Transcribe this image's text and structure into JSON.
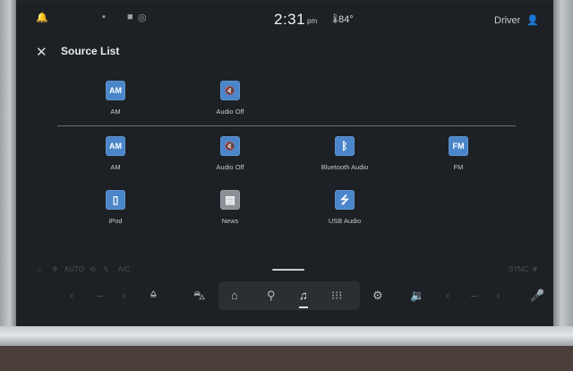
{
  "status_bar": {
    "time": "2:31",
    "ampm": "pm",
    "temperature": "84°",
    "user": "Driver",
    "icons": [
      "notification-bell-icon",
      "chat-icon",
      "message-icon",
      "target-icon",
      "thermometer-icon",
      "person-icon"
    ]
  },
  "header": {
    "title": "Source List",
    "close_icon": "close-icon"
  },
  "recent_sources": [
    {
      "label": "AM",
      "icon": "am-radio-icon",
      "tile_text": "AM"
    },
    {
      "label": "Audio Off",
      "icon": "audio-off-icon",
      "tile_text": "🔇"
    }
  ],
  "all_sources": [
    {
      "label": "AM",
      "icon": "am-radio-icon",
      "tile_text": "AM"
    },
    {
      "label": "Audio Off",
      "icon": "audio-off-icon",
      "tile_text": "🔇"
    },
    {
      "label": "Bluetooth Audio",
      "icon": "bluetooth-icon",
      "tile_text": "ᛒ"
    },
    {
      "label": "FM",
      "icon": "fm-radio-icon",
      "tile_text": "FM"
    },
    {
      "label": "iPod",
      "icon": "ipod-icon",
      "tile_text": "▯"
    },
    {
      "label": "News",
      "icon": "news-icon",
      "tile_text": "▤"
    },
    {
      "label": "USB Audio",
      "icon": "usb-icon",
      "tile_text": "⭍"
    }
  ],
  "climate_row": {
    "auto": "AUTO",
    "ac": "A/C",
    "sync": "SYNC"
  },
  "colors": {
    "screen_bg": "#1d2024",
    "tile_blue": "#4a86c9",
    "tile_gray": "#8a9096",
    "accent_red": "#d64a5a"
  }
}
